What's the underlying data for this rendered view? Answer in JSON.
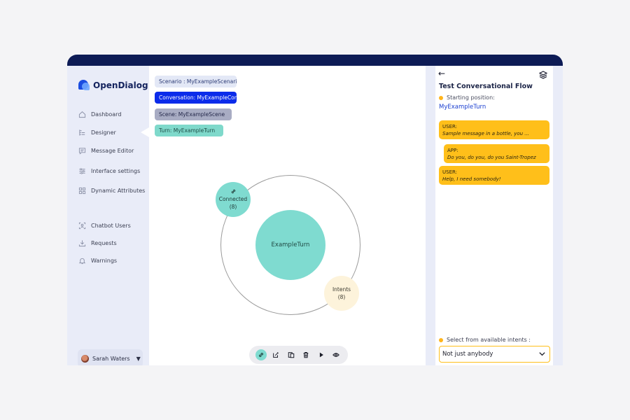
{
  "app": {
    "name": "OpenDialog"
  },
  "colors": {
    "topbar": "#0d1b55",
    "accent_teal": "#7fdbd0",
    "accent_yellow": "#ffbf1a",
    "brand_blue": "#0b2bea"
  },
  "sidebar": {
    "items": [
      {
        "label": "Dashboard",
        "icon": "home-icon"
      },
      {
        "label": "Designer",
        "icon": "designer-icon"
      },
      {
        "label": "Message Editor",
        "icon": "message-icon"
      },
      {
        "label": "Interface settings",
        "icon": "sliders-icon"
      },
      {
        "label": "Dynamic Attributes",
        "icon": "grid-icon"
      },
      {
        "label": "Chatbot Users",
        "icon": "users-icon"
      },
      {
        "label": "Requests",
        "icon": "download-icon"
      },
      {
        "label": "Warnings",
        "icon": "bell-icon"
      }
    ],
    "user": {
      "name": "Sarah Waters"
    }
  },
  "breadcrumbs": {
    "scenario": "Scenario : MyExampleScenario",
    "conversation": "Conversation: MyExampleConversation",
    "scene": "Scene: MyExampleScene",
    "turn": "Turn: MyExampleTurn"
  },
  "graph": {
    "center": "ExampleTurn",
    "connected": {
      "label": "Connected",
      "count": "(8)"
    },
    "intents": {
      "label": "Intents",
      "count": "(8)"
    }
  },
  "toolbar": [
    "link-icon",
    "edit-icon",
    "copy-icon",
    "trash-icon",
    "play-icon",
    "eye-icon"
  ],
  "panel": {
    "title": "Test Conversational Flow",
    "start_label": "Starting position:",
    "start_value": "MyExampleTurn",
    "messages": [
      {
        "role": "USER:",
        "text": "Sample message in a bottle, you ..."
      },
      {
        "role": "APP:",
        "text": "Do you, do you, do you Saint-Tropez"
      },
      {
        "role": "USER:",
        "text": "Help, I need somebody!"
      }
    ],
    "select_label": "Select from available intents :",
    "select_value": "Not just anybody"
  }
}
